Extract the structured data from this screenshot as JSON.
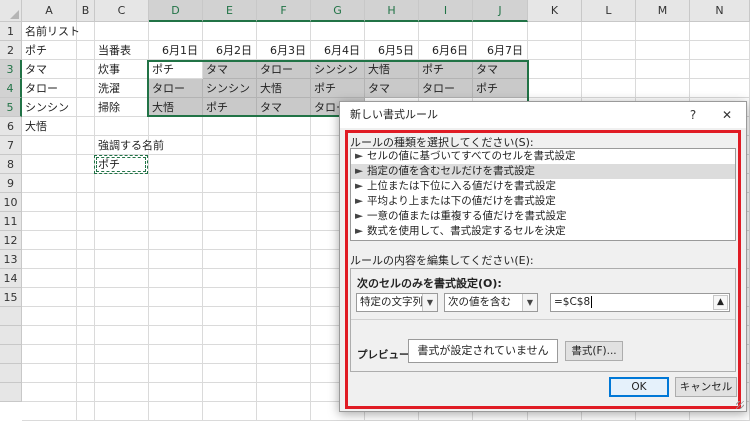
{
  "columns": [
    "A",
    "B",
    "C",
    "D",
    "E",
    "F",
    "G",
    "H",
    "I",
    "J",
    "K",
    "L",
    "M",
    "N"
  ],
  "rows": [
    "1",
    "2",
    "3",
    "4",
    "5",
    "6",
    "7",
    "8",
    "9",
    "10",
    "11",
    "12",
    "13",
    "14",
    "15"
  ],
  "cells": {
    "a1": "名前リスト",
    "a2": "ポチ",
    "a3": "タマ",
    "a4": "タロー",
    "a5": "シンシン",
    "a6": "大悟",
    "c2": "当番表",
    "c3": "炊事",
    "c4": "洗濯",
    "c5": "掃除",
    "c7": "強調する名前",
    "c8": "ポチ",
    "dates": [
      "6月1日",
      "6月2日",
      "6月3日",
      "6月4日",
      "6月5日",
      "6月6日",
      "6月7日"
    ],
    "grid": [
      [
        "ポチ",
        "タマ",
        "タロー",
        "シンシン",
        "大悟",
        "ポチ",
        "タマ"
      ],
      [
        "タロー",
        "シンシン",
        "大悟",
        "ポチ",
        "タマ",
        "タロー",
        "ポチ"
      ],
      [
        "大悟",
        "ポチ",
        "タマ",
        "タロー",
        "",
        "",
        ""
      ]
    ]
  },
  "dialog": {
    "title": "新しい書式ルール",
    "help": "?",
    "close": "✕",
    "rule_type_label": "ルールの種類を選択してください(S):",
    "rule_types": [
      "セルの値に基づいてすべてのセルを書式設定",
      "指定の値を含むセルだけを書式設定",
      "上位または下位に入る値だけを書式設定",
      "平均より上または下の値だけを書式設定",
      "一意の値または重複する値だけを書式設定",
      "数式を使用して、書式設定するセルを決定"
    ],
    "rule_edit_label": "ルールの内容を編集してください(E):",
    "format_only_label": "次のセルのみを書式設定(O):",
    "combo1": "特定の文字列",
    "combo2": "次の値を含む",
    "formula": "=$C$8",
    "preview_label": "プレビュー:",
    "preview_text": "書式が設定されていません",
    "format_button": "書式(F)...",
    "ok": "OK",
    "cancel": "キャンセル"
  },
  "colors": {
    "selection": "#217346",
    "shade": "#c9c9c9",
    "highlight_frame": "#e01b24"
  }
}
